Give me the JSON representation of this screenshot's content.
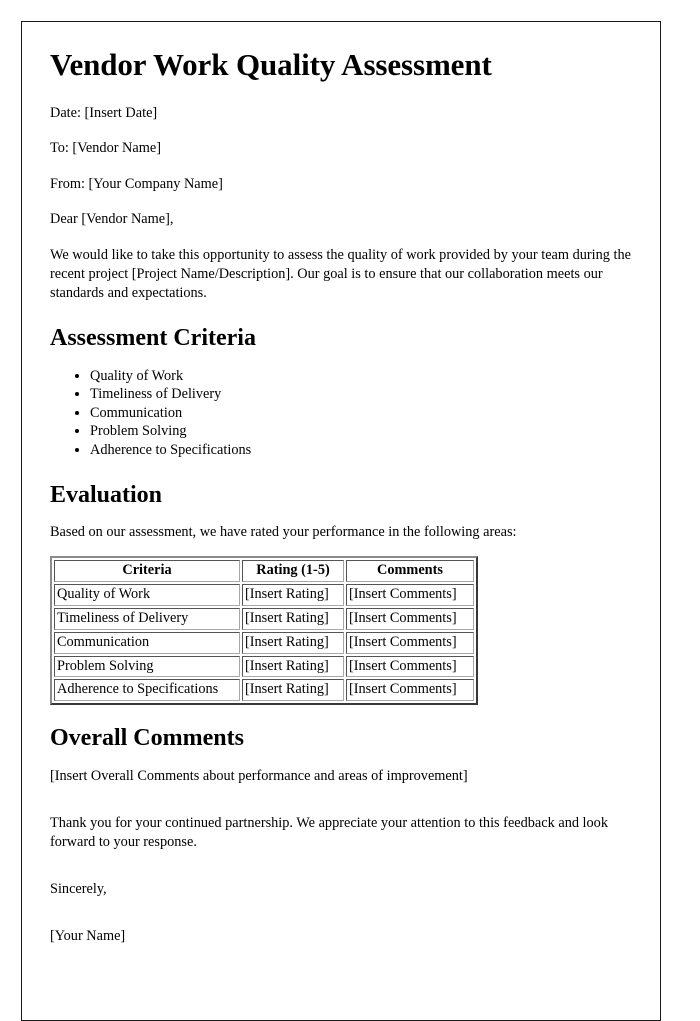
{
  "document": {
    "title": "Vendor Work Quality Assessment",
    "meta_lines": [
      "Date: [Insert Date]",
      "To: [Vendor Name]",
      "From: [Your Company Name]"
    ],
    "salutation": "Dear [Vendor Name],",
    "intro_paragraph": "We would like to take this opportunity to assess the quality of work provided by your team during the recent project [Project Name/Description]. Our goal is to ensure that our collaboration meets our standards and expectations.",
    "sections": {
      "assessment_criteria": {
        "heading": "Assessment Criteria",
        "items": [
          "Quality of Work",
          "Timeliness of Delivery",
          "Communication",
          "Problem Solving",
          "Adherence to Specifications"
        ]
      },
      "evaluation": {
        "heading": "Evaluation",
        "lead_in": "Based on our assessment, we have rated your performance in the following areas:",
        "table": {
          "columns": [
            "Criteria",
            "Rating (1-5)",
            "Comments"
          ],
          "rows": [
            [
              "Quality of Work",
              "[Insert Rating]",
              "[Insert Comments]"
            ],
            [
              "Timeliness of Delivery",
              "[Insert Rating]",
              "[Insert Comments]"
            ],
            [
              "Communication",
              "[Insert Rating]",
              "[Insert Comments]"
            ],
            [
              "Problem Solving",
              "[Insert Rating]",
              "[Insert Comments]"
            ],
            [
              "Adherence to Specifications",
              "[Insert Rating]",
              "[Insert Comments]"
            ]
          ]
        }
      },
      "overall_comments": {
        "heading": "Overall Comments",
        "placeholder": "[Insert Overall Comments about performance and areas of improvement]",
        "closing_paragraph": "Thank you for your continued partnership. We appreciate your attention to this feedback and look forward to your response."
      }
    },
    "signoff": {
      "closing": "Sincerely,",
      "name": "[Your Name]"
    }
  }
}
